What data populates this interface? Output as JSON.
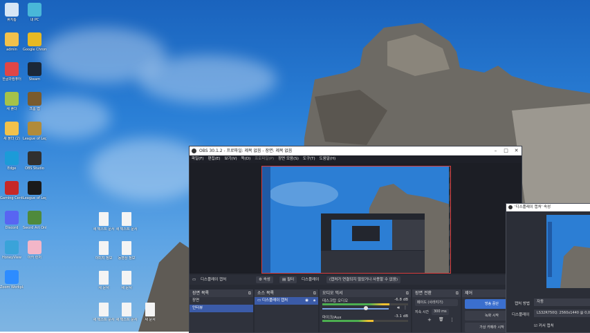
{
  "desktop": {
    "icons_left": [
      {
        "label": "휴지통",
        "color": "#d7e6f5"
      },
      {
        "label": "admin",
        "color": "#f2c14b"
      },
      {
        "label": "한글과컴퓨터",
        "color": "#e04646"
      },
      {
        "label": "새 폴더",
        "color": "#a6c24a"
      },
      {
        "label": "새 폴더 (2)",
        "color": "#f2c14b"
      },
      {
        "label": "Edge",
        "color": "#1c9bd8"
      },
      {
        "label": "Gaming Center",
        "color": "#c62828"
      },
      {
        "label": "Discord",
        "color": "#5865f2"
      },
      {
        "label": "HoneyView",
        "color": "#3aa3d9"
      },
      {
        "label": "Zoom Workplace",
        "color": "#2d8cff"
      }
    ],
    "icons_right": [
      {
        "label": "내 PC",
        "color": "#49b7d8"
      },
      {
        "label": "Google Chrome",
        "color": "#e7b923"
      },
      {
        "label": "Steam",
        "color": "#1b2838"
      },
      {
        "label": "크롬 앱",
        "color": "#7a5b2d"
      },
      {
        "label": "League of Legends",
        "color": "#b18b3a"
      },
      {
        "label": "OBS Studio",
        "color": "#303030"
      },
      {
        "label": "League of Legends",
        "color": "#1a1a1a"
      },
      {
        "label": "Sword Art Online",
        "color": "#4f8a3c"
      },
      {
        "label": "아카 런처",
        "color": "#f3b6c8"
      }
    ],
    "files": [
      {
        "label": "새 텍스트 문서"
      },
      {
        "label": "새 텍스트 문서"
      },
      {
        "label": "이미지 정보"
      },
      {
        "label": "동영상 정보"
      },
      {
        "label": "새 문서"
      },
      {
        "label": "새 문서"
      },
      {
        "label": "새 텍스트 문서"
      },
      {
        "label": "새 텍스트 문서"
      },
      {
        "label": "새 문서"
      }
    ]
  },
  "obs": {
    "title": "OBS 30.1.2 - 프로파일: 제목 없음 - 장면: 제목 없음",
    "window_buttons": [
      "–",
      "□",
      "✕"
    ],
    "menu": [
      "파일(F)",
      "편집(E)",
      "보기(V)",
      "독(D)",
      "프로파일(P)",
      "장면 모음(S)",
      "도구(T)",
      "도움말(H)"
    ],
    "toolbar": {
      "source_name": "디스플레이 캡처",
      "properties": "속성",
      "filters": "필터",
      "display_label": "디스플레이",
      "display_value": "(캡처가 연결되지 않았거나 사용할 수 없음)"
    },
    "scenes": {
      "header": "장면 목록",
      "items": [
        "장면",
        "인터뷰"
      ],
      "selected": 1
    },
    "sources": {
      "header": "소스 목록",
      "items": [
        "디스플레이 캡처"
      ]
    },
    "audio": {
      "header": "오디오 믹서",
      "channels": [
        {
          "name": "데스크탑 오디오",
          "db": "-6.8 dB",
          "level": 0.78
        },
        {
          "name": "마이크/Aux",
          "db": "-3.1 dB",
          "level": 0.6
        }
      ]
    },
    "transitions": {
      "header": "장면 전환",
      "type": "페이드 (사라지기)",
      "duration_label": "지속 시간",
      "duration_value": "300 ms"
    },
    "controls": {
      "header": "제어",
      "buttons": [
        "방송 중단",
        "녹화 시작",
        "가상 카메라 시작"
      ],
      "active": 0
    }
  },
  "properties": {
    "title": "'디스플레이 캡처' 속성",
    "capture_method_label": "캡처 방법",
    "capture_method_value": "자동",
    "display_label": "디스플레이",
    "display_value": "LS32R750Q: 2560x1440 @ 0,0",
    "cursor_label": "커서 캡처"
  }
}
